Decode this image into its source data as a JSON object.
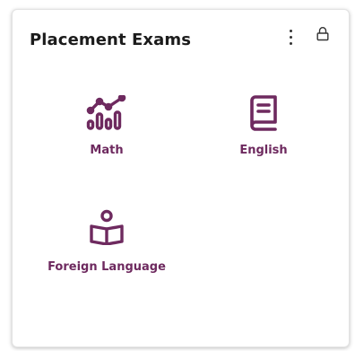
{
  "card": {
    "title": "Placement Exams"
  },
  "header": {
    "more_icon": "vertical-dots-icon",
    "lock_icon": "lock-icon"
  },
  "tiles": [
    {
      "label": "Math",
      "icon": "chart-icon"
    },
    {
      "label": "English",
      "icon": "book-icon"
    },
    {
      "label": "Foreign Language",
      "icon": "reader-icon"
    }
  ],
  "colors": {
    "accent": "#6e2a5f",
    "title": "#1c1c1c"
  }
}
